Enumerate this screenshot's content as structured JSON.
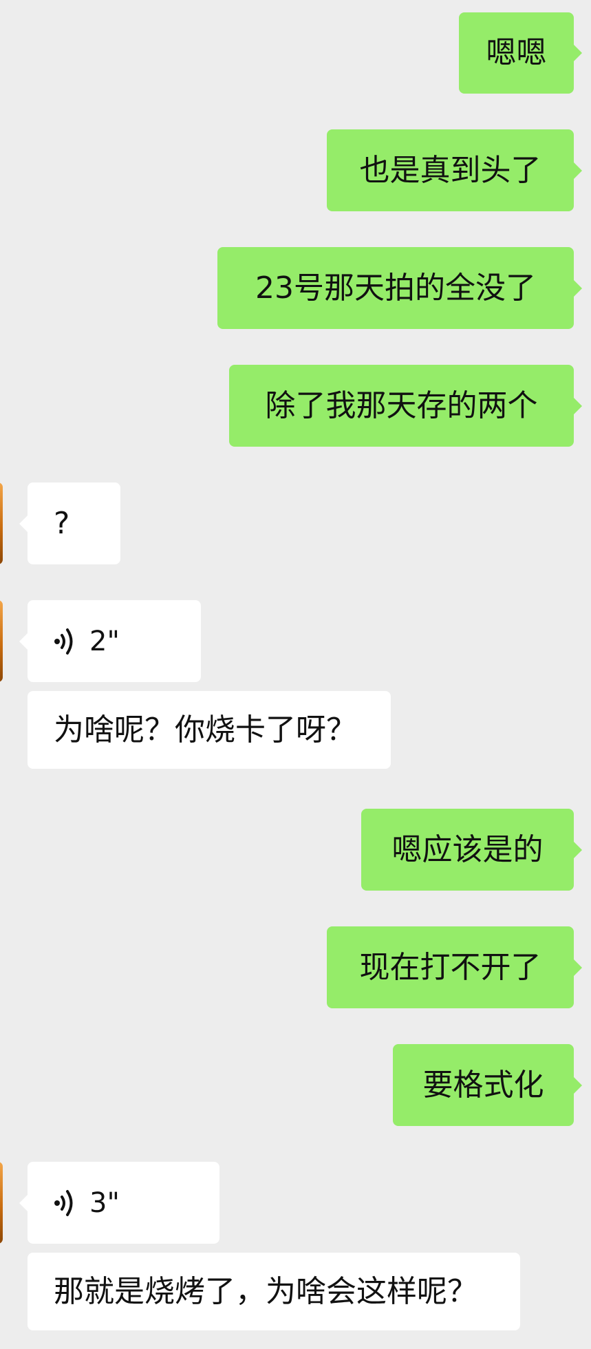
{
  "chat": {
    "messages": [
      {
        "side": "right",
        "type": "text",
        "text": "嗯嗯"
      },
      {
        "side": "right",
        "type": "text",
        "text": "也是真到头了"
      },
      {
        "side": "right",
        "type": "text",
        "text": "23号那天拍的全没了"
      },
      {
        "side": "right",
        "type": "text",
        "text": "除了我那天存的两个"
      },
      {
        "side": "left",
        "type": "text",
        "text": "?"
      },
      {
        "side": "left",
        "type": "voice",
        "duration": "2\""
      },
      {
        "side": "left",
        "type": "text",
        "text": "为啥呢？你烧卡了呀？"
      },
      {
        "side": "right",
        "type": "text",
        "text": "嗯应该是的"
      },
      {
        "side": "right",
        "type": "text",
        "text": "现在打不开了"
      },
      {
        "side": "right",
        "type": "text",
        "text": "要格式化"
      },
      {
        "side": "left",
        "type": "voice",
        "duration": "3\""
      },
      {
        "side": "left",
        "type": "text",
        "text": "那就是烧烤了，为啥会这样呢？"
      }
    ]
  },
  "colors": {
    "background": "#ededed",
    "outgoing_bubble": "#95ec69",
    "incoming_bubble": "#ffffff",
    "text": "#111111",
    "avatar_accent": "#d97b16"
  },
  "icons": {
    "voice": "voice-wave-icon",
    "avatar": "avatar"
  }
}
